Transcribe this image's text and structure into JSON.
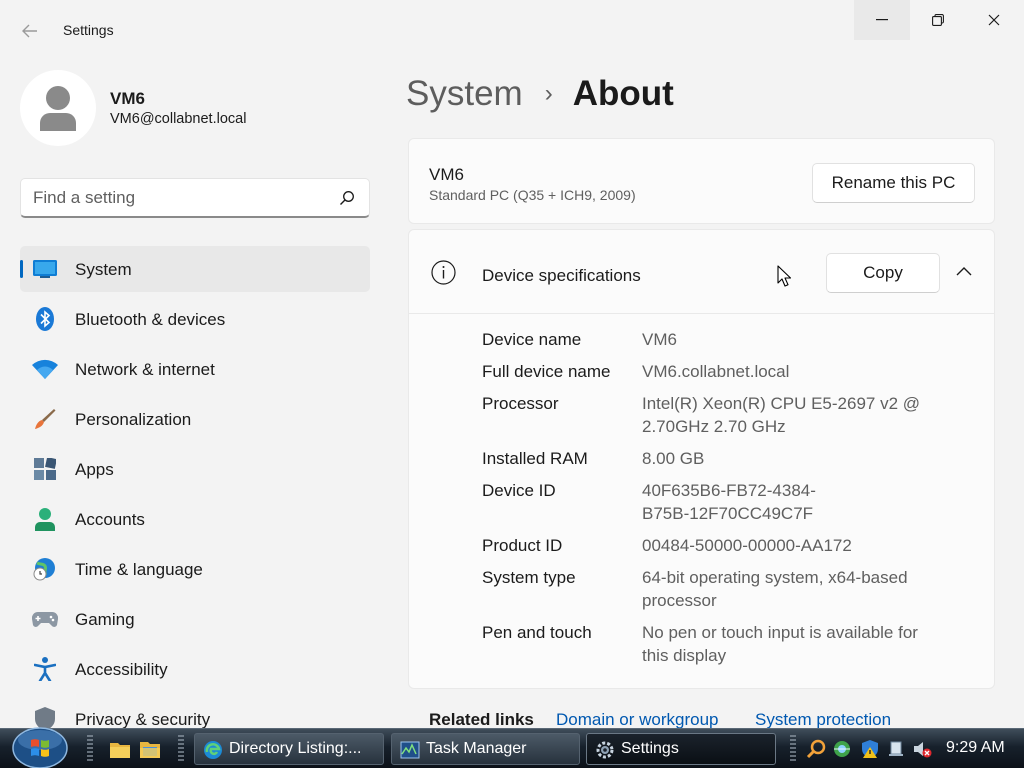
{
  "window": {
    "title": "Settings"
  },
  "user": {
    "name": "VM6",
    "email": "VM6@collabnet.local"
  },
  "search": {
    "placeholder": "Find a setting"
  },
  "nav": {
    "items": [
      {
        "label": "System",
        "icon": "system-icon",
        "active": true
      },
      {
        "label": "Bluetooth & devices",
        "icon": "bluetooth-icon"
      },
      {
        "label": "Network & internet",
        "icon": "wifi-icon"
      },
      {
        "label": "Personalization",
        "icon": "brush-icon"
      },
      {
        "label": "Apps",
        "icon": "apps-icon"
      },
      {
        "label": "Accounts",
        "icon": "person-icon"
      },
      {
        "label": "Time & language",
        "icon": "globe-clock-icon"
      },
      {
        "label": "Gaming",
        "icon": "gamepad-icon"
      },
      {
        "label": "Accessibility",
        "icon": "accessibility-icon"
      },
      {
        "label": "Privacy & security",
        "icon": "shield-icon"
      }
    ]
  },
  "breadcrumb": {
    "parent": "System",
    "separator": "›",
    "current": "About"
  },
  "pc": {
    "name": "VM6",
    "model": "Standard PC (Q35 + ICH9, 2009)",
    "rename_label": "Rename this PC"
  },
  "device_specs": {
    "title": "Device specifications",
    "copy_label": "Copy",
    "rows": [
      {
        "label": "Device name",
        "value": "VM6"
      },
      {
        "label": "Full device name",
        "value": "VM6.collabnet.local"
      },
      {
        "label": "Processor",
        "value": "Intel(R) Xeon(R) CPU E5-2697 v2 @\n2.70GHz   2.70 GHz"
      },
      {
        "label": "Installed RAM",
        "value": "8.00 GB"
      },
      {
        "label": "Device ID",
        "value": "40F635B6-FB72-4384-\nB75B-12F70CC49C7F"
      },
      {
        "label": "Product ID",
        "value": "00484-50000-00000-AA172"
      },
      {
        "label": "System type",
        "value": "64-bit operating system, x64-based\nprocessor"
      },
      {
        "label": "Pen and touch",
        "value": "No pen or touch input is available for\nthis display"
      }
    ]
  },
  "related": {
    "title": "Related links",
    "links": [
      "Domain or workgroup",
      "System protection"
    ]
  },
  "taskbar": {
    "tasks": [
      {
        "label": "Directory Listing:...",
        "icon": "edge-icon"
      },
      {
        "label": "Task Manager",
        "icon": "task-manager-icon"
      },
      {
        "label": "Settings",
        "icon": "settings-gear-icon",
        "active": true
      }
    ],
    "clock": "9:29 AM"
  },
  "colors": {
    "accent": "#0067c0",
    "link": "#0058b0",
    "background": "#f3f3f3",
    "card": "#fbfbfb"
  }
}
